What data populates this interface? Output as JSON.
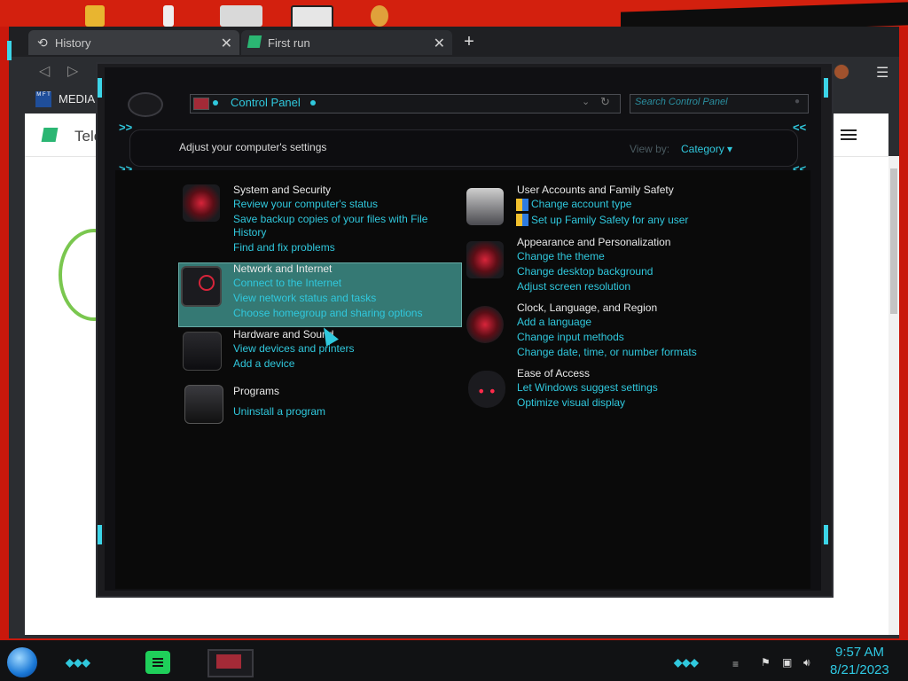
{
  "browser": {
    "tabs": [
      {
        "label": "History",
        "icon": "history-icon"
      },
      {
        "label": "First run",
        "icon": "app-logo-icon"
      }
    ],
    "new_tab_label": "+",
    "close_label": "✕",
    "bookmark_label": "MEDIAF",
    "bookmark_icon_text": "M F T",
    "page_partial_title": "Tele"
  },
  "control_panel": {
    "address": "Control Panel",
    "search_placeholder": "Search Control Panel",
    "header_title": "Adjust your computer's settings",
    "view_by_label": "View by:",
    "view_by_value": "Category ▾",
    "left_categories": [
      {
        "title": "System and Security",
        "links": [
          "Review your computer's status",
          "Save backup copies of your files with File History",
          "Find and fix problems"
        ]
      },
      {
        "title": "Network and Internet",
        "links": [
          "Connect to the Internet",
          "View network status and tasks",
          "Choose homegroup and sharing options"
        ]
      },
      {
        "title": "Hardware and Sound",
        "links": [
          "View devices and printers",
          "Add a device"
        ]
      },
      {
        "title": "Programs",
        "links": [
          "Uninstall a program"
        ]
      }
    ],
    "right_categories": [
      {
        "title": "User Accounts and Family Safety",
        "links": [
          "Change account type",
          "Set up Family Safety for any user"
        ]
      },
      {
        "title": "Appearance and Personalization",
        "links": [
          "Change the theme",
          "Change desktop background",
          "Adjust screen resolution"
        ]
      },
      {
        "title": "Clock, Language, and Region",
        "links": [
          "Add a language",
          "Change input methods",
          "Change date, time, or number formats"
        ]
      },
      {
        "title": "Ease of Access",
        "links": [
          "Let Windows suggest settings",
          "Optimize visual display"
        ]
      }
    ]
  },
  "taskbar": {
    "time": "9:57 AM",
    "date": "8/21/2023"
  },
  "colors": {
    "accent": "#30c8dd",
    "desktop": "#c9180c",
    "highlight": "#3d8d87"
  }
}
